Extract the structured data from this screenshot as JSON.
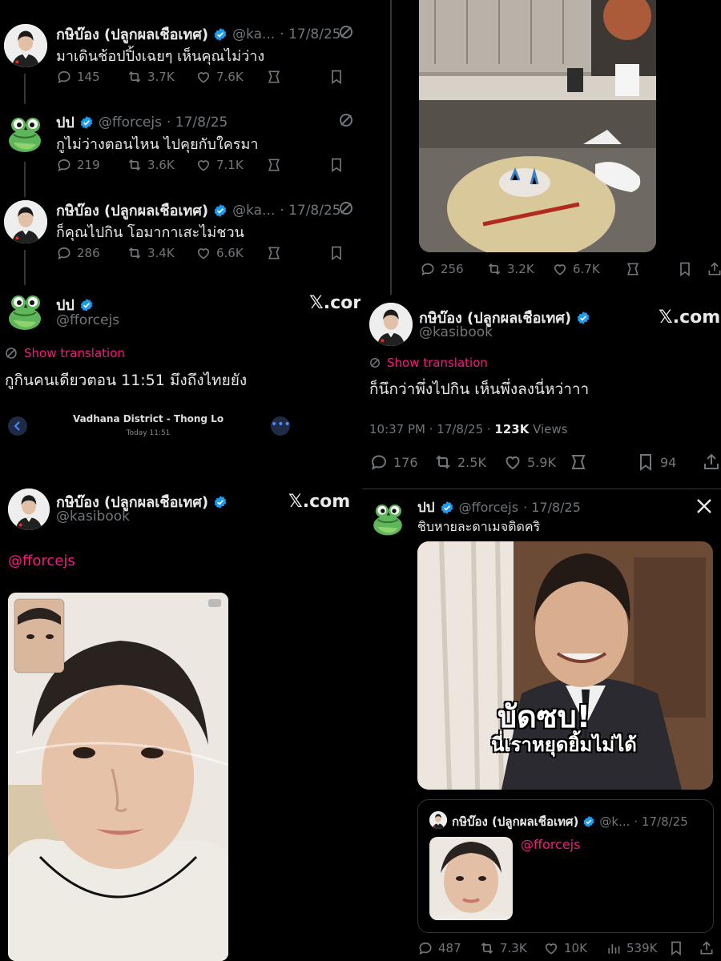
{
  "left": {
    "thread": [
      {
        "name": "กษิบ๊อง (ปลูกผลเชือเทศ)",
        "handle": "@ka...",
        "date": "· 17/8/25",
        "text": "มาเดินช้อปปิ้งเฉยๆ เห็นคุณไม่ว่าง",
        "replies": "145",
        "reposts": "3.7K",
        "likes": "7.6K"
      },
      {
        "name": "ปป",
        "handle": "@fforcejs",
        "date": "· 17/8/25",
        "text": "กูไม่ว่างตอนไหน ไปคุยกับใครมา",
        "replies": "219",
        "reposts": "3.6K",
        "likes": "7.1K"
      },
      {
        "name": "กษิบ๊อง (ปลูกผลเชือเทศ)",
        "handle": "@ka...",
        "date": "· 17/8/25",
        "text": "ก็คุณไปกิน โอมากาเสะไม่ชวน",
        "replies": "286",
        "reposts": "3.4K",
        "likes": "6.6K"
      }
    ],
    "main": {
      "name": "ปป",
      "handle": "@fforcejs",
      "xcom": "𝕏.cor",
      "translate": "Show translation",
      "text": "กูกินคนเดียวตอน 11:51 มึงถึงไทยยัง"
    },
    "location": {
      "title": "Vadhana District - Thong Lo",
      "time": "Today  11:51"
    },
    "bottom": {
      "name": "กษิบ๊อง (ปลูกผลเชือเทศ)",
      "handle": "@kasibook",
      "xcom": "𝕏.com",
      "mention": "@fforcejs"
    }
  },
  "right": {
    "top_stats": {
      "replies": "256",
      "reposts": "3.2K",
      "likes": "6.7K"
    },
    "tweet2": {
      "name": "กษิบ๊อง (ปลูกผลเชือเทศ)",
      "handle": "@kasibook",
      "xcom": "𝕏.com",
      "translate": "Show translation",
      "text": "ก็นึกว่าพึ่งไปกิน เห็นพึ่งลงนี่หว่าาา",
      "time": "10:37 PM · 17/8/25 · ",
      "views_num": "123K",
      "views_label": " Views",
      "replies": "176",
      "reposts": "2.5K",
      "likes": "5.9K",
      "bookmarks": "94"
    },
    "tweet3": {
      "name": "ปป",
      "handle": "@fforcejs",
      "date": "· 17/8/25",
      "text": "ชิบหายละดาเมจติดคริ",
      "meme_line1": "บัดซบ!",
      "meme_line2": "นี่เราหยุดยิ้มไม่ได้",
      "quote_name": "กษิบ๊อง (ปลูกผลเชือเทศ)",
      "quote_handle": "@k...",
      "quote_date": "· 17/8/25",
      "quote_mention": "@fforcejs",
      "replies": "487",
      "reposts": "7.3K",
      "likes": "10K",
      "views": "539K"
    }
  },
  "colors": {
    "bg": "#000000",
    "text": "#e7e9ea",
    "muted": "#71767b",
    "verified": "#1d9bf0",
    "accent": "#f91880"
  }
}
